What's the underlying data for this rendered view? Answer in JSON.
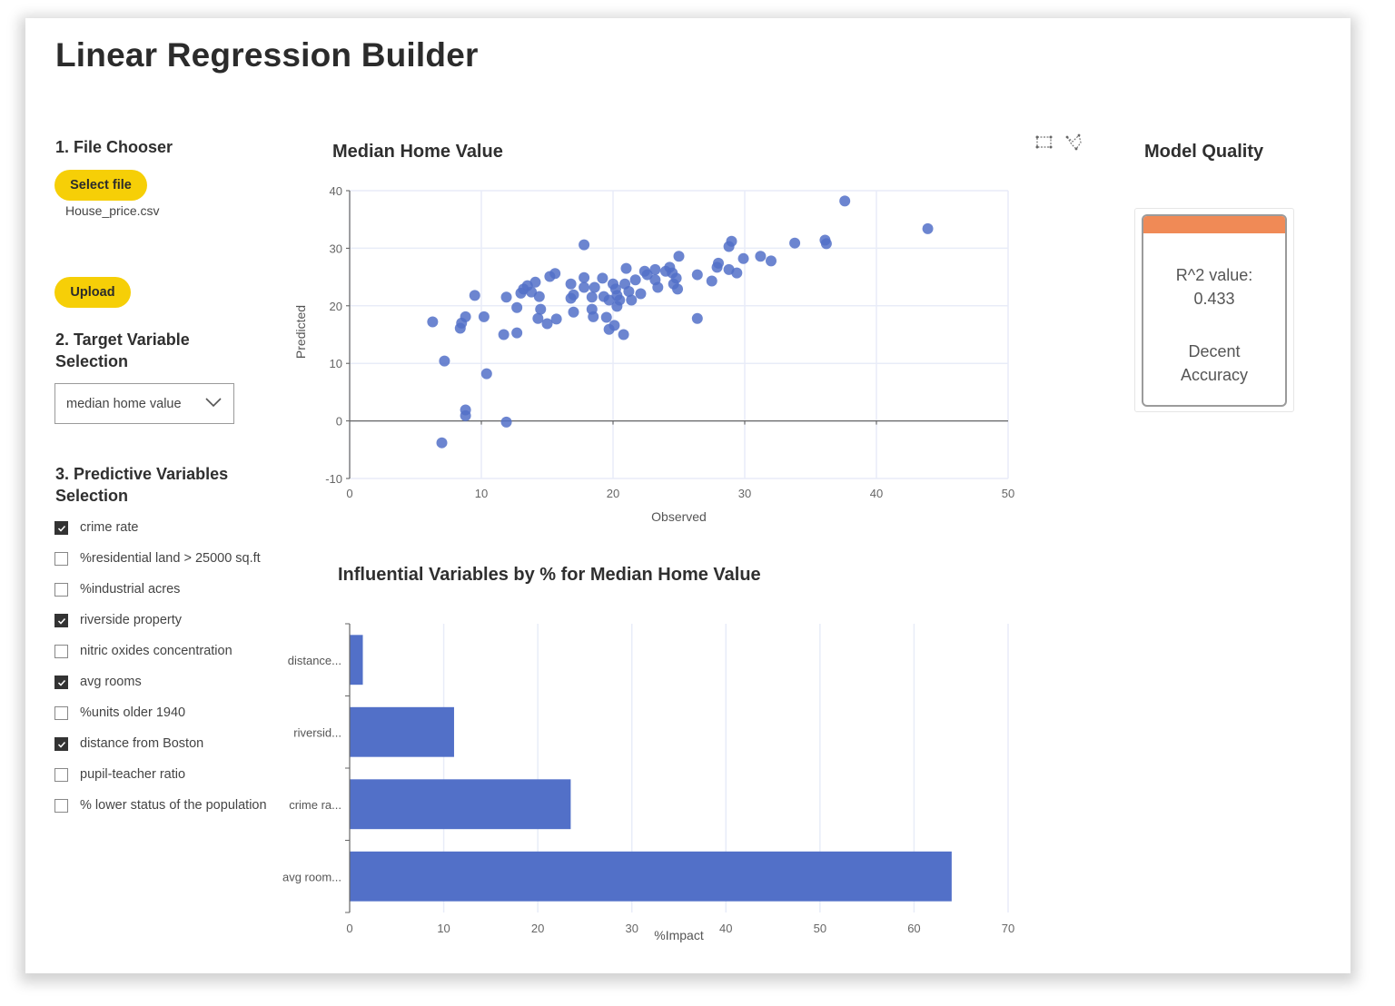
{
  "app": {
    "title": "Linear Regression Builder"
  },
  "file_chooser": {
    "heading": "1. File Chooser",
    "select_label": "Select file",
    "file_name": "House_price.csv",
    "upload_label": "Upload"
  },
  "target": {
    "heading_line1": "2. Target Variable",
    "heading_line2": "Selection",
    "selected": "median home value",
    "icon": "chevron-down-icon"
  },
  "predictors": {
    "heading_line1": "3. Predictive Variables",
    "heading_line2": "Selection",
    "items": [
      {
        "label": "crime rate",
        "checked": true
      },
      {
        "label": "%residential land > 25000 sq.ft",
        "checked": false
      },
      {
        "label": "%industrial acres",
        "checked": false
      },
      {
        "label": "riverside property",
        "checked": true
      },
      {
        "label": "nitric oxides concentration",
        "checked": false
      },
      {
        "label": "avg rooms",
        "checked": true
      },
      {
        "label": "%units older 1940",
        "checked": false
      },
      {
        "label": "distance from Boston",
        "checked": true
      },
      {
        "label": "pupil-teacher ratio",
        "checked": false
      },
      {
        "label": "% lower status of the population",
        "checked": false
      }
    ]
  },
  "toolbar": {
    "icons": [
      "box-select-icon",
      "lasso-select-icon"
    ]
  },
  "model_quality": {
    "heading": "Model Quality",
    "r2_label": "R^2 value:",
    "r2_value": "0.433",
    "rating_line1": "Decent",
    "rating_line2": "Accuracy",
    "accent_color": "#f08a56"
  },
  "colors": {
    "marker": "#5270c8",
    "accent_button": "#f6cf07"
  },
  "chart_data": [
    {
      "type": "scatter",
      "title": "Median Home Value",
      "xlabel": "Observed",
      "ylabel": "Predicted",
      "xlim": [
        0,
        50
      ],
      "ylim": [
        -10,
        40
      ],
      "xticks": [
        "0",
        "10",
        "20",
        "30",
        "40",
        "50"
      ],
      "yticks": [
        "-10",
        "0",
        "10",
        "20",
        "30",
        "40"
      ],
      "grid": true,
      "points": [
        [
          6.3,
          17.2
        ],
        [
          7.2,
          10.4
        ],
        [
          7.0,
          -3.8
        ],
        [
          8.4,
          16.1
        ],
        [
          8.5,
          17.0
        ],
        [
          8.8,
          18.1
        ],
        [
          8.8,
          1.9
        ],
        [
          8.8,
          0.9
        ],
        [
          9.5,
          21.8
        ],
        [
          10.2,
          18.1
        ],
        [
          10.4,
          8.2
        ],
        [
          11.7,
          15.0
        ],
        [
          11.9,
          -0.2
        ],
        [
          11.9,
          21.5
        ],
        [
          12.7,
          15.3
        ],
        [
          12.7,
          19.7
        ],
        [
          13.0,
          22.2
        ],
        [
          13.2,
          22.9
        ],
        [
          13.5,
          23.5
        ],
        [
          13.8,
          22.4
        ],
        [
          14.1,
          24.1
        ],
        [
          14.4,
          21.6
        ],
        [
          14.5,
          19.4
        ],
        [
          14.3,
          17.8
        ],
        [
          15.0,
          16.9
        ],
        [
          15.2,
          25.1
        ],
        [
          15.6,
          25.6
        ],
        [
          15.7,
          17.7
        ],
        [
          16.8,
          23.8
        ],
        [
          16.8,
          21.3
        ],
        [
          17.0,
          18.9
        ],
        [
          17.0,
          21.9
        ],
        [
          17.8,
          30.6
        ],
        [
          17.8,
          24.9
        ],
        [
          17.8,
          23.2
        ],
        [
          18.4,
          21.5
        ],
        [
          18.4,
          19.4
        ],
        [
          18.5,
          18.1
        ],
        [
          18.6,
          23.2
        ],
        [
          19.2,
          24.8
        ],
        [
          19.3,
          21.6
        ],
        [
          19.5,
          18.0
        ],
        [
          19.7,
          21.0
        ],
        [
          19.7,
          15.9
        ],
        [
          20.0,
          23.8
        ],
        [
          20.1,
          16.6
        ],
        [
          20.2,
          22.9
        ],
        [
          20.3,
          21.8
        ],
        [
          20.3,
          19.9
        ],
        [
          20.5,
          21.0
        ],
        [
          20.8,
          15.0
        ],
        [
          20.9,
          23.8
        ],
        [
          21.0,
          26.5
        ],
        [
          21.2,
          22.5
        ],
        [
          21.4,
          21.0
        ],
        [
          21.7,
          24.5
        ],
        [
          22.1,
          22.1
        ],
        [
          22.4,
          26.0
        ],
        [
          22.6,
          25.4
        ],
        [
          23.2,
          26.3
        ],
        [
          23.2,
          24.5
        ],
        [
          23.4,
          23.2
        ],
        [
          24.0,
          26.0
        ],
        [
          24.3,
          26.7
        ],
        [
          24.5,
          25.7
        ],
        [
          24.6,
          23.8
        ],
        [
          24.8,
          24.8
        ],
        [
          24.9,
          22.9
        ],
        [
          25.0,
          28.6
        ],
        [
          26.4,
          25.4
        ],
        [
          26.4,
          17.8
        ],
        [
          27.5,
          24.3
        ],
        [
          27.9,
          26.7
        ],
        [
          28.0,
          27.4
        ],
        [
          28.8,
          26.3
        ],
        [
          28.8,
          30.3
        ],
        [
          29.0,
          31.2
        ],
        [
          29.4,
          25.7
        ],
        [
          29.9,
          28.2
        ],
        [
          31.2,
          28.6
        ],
        [
          32.0,
          27.8
        ],
        [
          33.8,
          30.9
        ],
        [
          36.1,
          31.4
        ],
        [
          36.2,
          30.8
        ],
        [
          37.6,
          38.2
        ],
        [
          43.9,
          33.4
        ]
      ]
    },
    {
      "type": "bar",
      "orientation": "horizontal",
      "title": "Influential Variables by % for Median Home Value",
      "xlabel": "%Impact",
      "ylabel": "",
      "categories": [
        "distance...",
        "riversid...",
        "crime ra...",
        "avg room..."
      ],
      "values": [
        1.4,
        11.1,
        23.5,
        64.0
      ],
      "xlim": [
        0,
        70
      ],
      "xticks": [
        "0",
        "10",
        "20",
        "30",
        "40",
        "50",
        "60",
        "70"
      ],
      "grid": true
    }
  ]
}
